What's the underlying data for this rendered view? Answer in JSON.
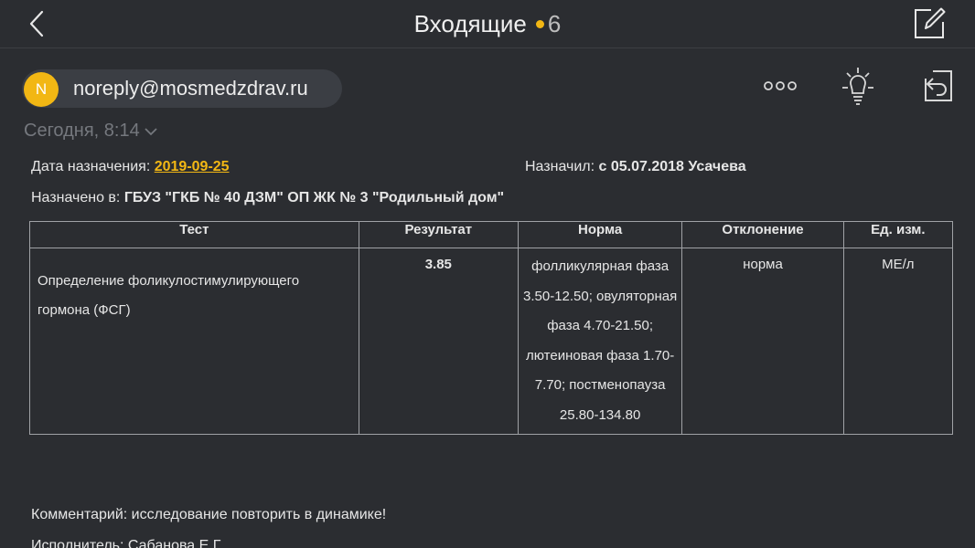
{
  "colors": {
    "accent": "#f2b714",
    "background": "#2b2d31"
  },
  "header": {
    "back_icon": "chevron-left-icon",
    "title": "Входящие",
    "unread_count": "6",
    "compose_icon": "compose-icon"
  },
  "message": {
    "avatar_letter": "N",
    "sender": "noreply@mosmedzdrav.ru",
    "date": "Сегодня, 8:14",
    "actions": [
      "more-icon",
      "bulb-icon",
      "reply-icon"
    ]
  },
  "body": {
    "assign_date_label": "Дата назначения:",
    "assign_date_value": "2019-09-25",
    "assigned_by_label": "Назначил:",
    "assigned_by_value": "с 05.07.2018 Усачева",
    "assigned_at_label": "Назначено в:",
    "assigned_at_value": "ГБУЗ \"ГКБ № 40 ДЗМ\" ОП ЖК № 3 \"Родильный дом\"",
    "table": {
      "headers": [
        "Тест",
        "Результат",
        "Норма",
        "Отклонение",
        "Ед. изм."
      ],
      "rows": [
        {
          "test": "Определение фоликулостимулирующего гормона (ФСГ)",
          "result": "3.85",
          "norm": "фолликулярная фаза 3.50-12.50; овуляторная фаза 4.70-21.50; лютеиновая фаза 1.70-7.70; постменопауза 25.80-134.80",
          "deviation": "норма",
          "unit": "МЕ/л"
        }
      ]
    },
    "comment": "Комментарий: исследование повторить в динамике!",
    "executor": "Исполнитель: Сабанова Е.Г."
  }
}
